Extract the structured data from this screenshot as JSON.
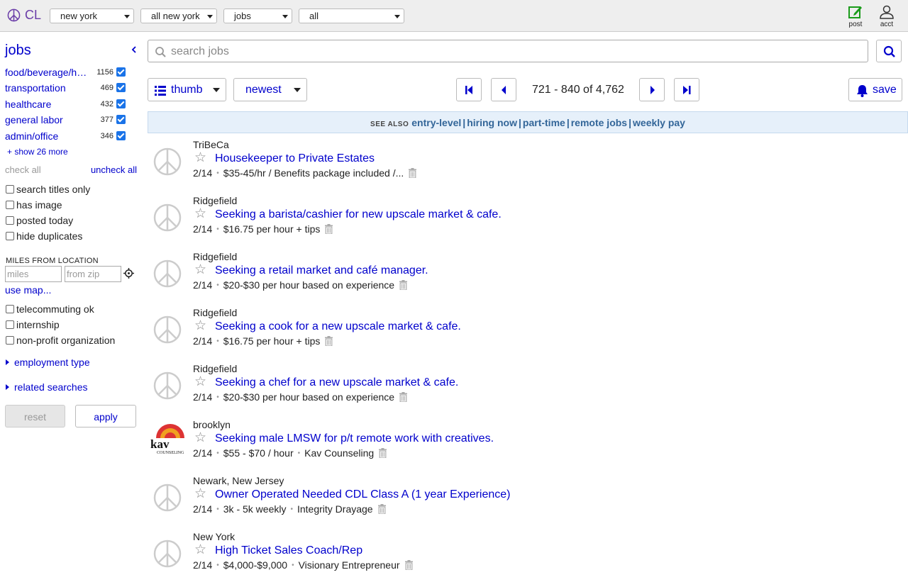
{
  "topbar": {
    "logo_text": "CL",
    "selects": [
      "new york",
      "all new york",
      "jobs",
      "all"
    ],
    "post_label": "post",
    "acct_label": "acct"
  },
  "sidebar": {
    "title": "jobs",
    "categories": [
      {
        "name": "food/beverage/hospitality",
        "count": "1156"
      },
      {
        "name": "transportation",
        "count": "469"
      },
      {
        "name": "healthcare",
        "count": "432"
      },
      {
        "name": "general labor",
        "count": "377"
      },
      {
        "name": "admin/office",
        "count": "346"
      }
    ],
    "show_more": "+ show 26 more",
    "check_all": "check all",
    "uncheck_all": "uncheck all",
    "options1": [
      "search titles only",
      "has image",
      "posted today",
      "hide duplicates"
    ],
    "miles_heading": "MILES FROM LOCATION",
    "miles_placeholder": "miles",
    "zip_placeholder": "from zip",
    "use_map": "use map...",
    "options2": [
      "telecommuting ok",
      "internship",
      "non-profit organization"
    ],
    "employment_type": "employment type",
    "related_searches": "related searches",
    "reset": "reset",
    "apply": "apply"
  },
  "main": {
    "search_placeholder": "search jobs",
    "view_mode": "thumb",
    "sort": "newest",
    "range_text": "721 - 840 of 4,762",
    "save": "save",
    "see_also_label": "SEE ALSO",
    "see_also": [
      "entry-level",
      "hiring now",
      "part-time",
      "remote jobs",
      "weekly pay"
    ]
  },
  "listings": [
    {
      "location": "TriBeCa",
      "title": "Housekeeper to Private Estates",
      "date": "2/14",
      "details": [
        "$35-45/hr / Benefits package included /..."
      ],
      "thumb": "peace"
    },
    {
      "location": "Ridgefield",
      "title": "Seeking a barista/cashier for new upscale market & cafe.",
      "date": "2/14",
      "details": [
        "$16.75 per hour + tips"
      ],
      "thumb": "peace"
    },
    {
      "location": "Ridgefield",
      "title": "Seeking a retail market and café manager.",
      "date": "2/14",
      "details": [
        "$20-$30 per hour based on experience"
      ],
      "thumb": "peace"
    },
    {
      "location": "Ridgefield",
      "title": "Seeking a cook for a new upscale market & cafe.",
      "date": "2/14",
      "details": [
        "$16.75 per hour + tips"
      ],
      "thumb": "peace"
    },
    {
      "location": "Ridgefield",
      "title": "Seeking a chef for a new upscale market & cafe.",
      "date": "2/14",
      "details": [
        "$20-$30 per hour based on experience"
      ],
      "thumb": "peace"
    },
    {
      "location": "brooklyn",
      "title": "Seeking male LMSW for p/t remote work with creatives.",
      "date": "2/14",
      "details": [
        "$55 - $70 / hour",
        "Kav Counseling"
      ],
      "thumb": "kav",
      "thumb_text": "kav",
      "thumb_sub": "COUNSELING"
    },
    {
      "location": "Newark, New Jersey",
      "title": "Owner Operated Needed CDL Class A (1 year Experience)",
      "date": "2/14",
      "details": [
        "3k - 5k weekly",
        "Integrity Drayage"
      ],
      "thumb": "peace"
    },
    {
      "location": "New York",
      "title": "High Ticket Sales Coach/Rep",
      "date": "2/14",
      "details": [
        "$4,000-$9,000",
        "Visionary Entrepreneur"
      ],
      "thumb": "peace"
    }
  ],
  "colors": {
    "link": "#0000cc",
    "logo": "#6a3da8",
    "accent_check": "#1a73e8",
    "see_also_bg": "#e6f0fa"
  }
}
